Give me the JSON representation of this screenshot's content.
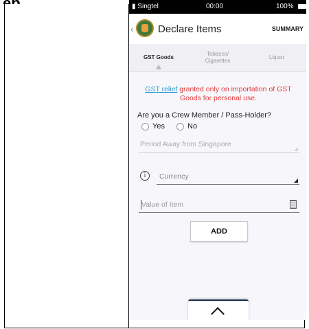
{
  "page": {
    "heading": "ep"
  },
  "status_bar": {
    "carrier": "Singtel",
    "time": "00:00",
    "battery": "100%"
  },
  "header": {
    "title": "Declare Items",
    "summary": "SUMMARY"
  },
  "tabs": [
    {
      "label": "GST Goods",
      "active": true
    },
    {
      "label": "Tobacco/\nCigarettes",
      "active": false
    },
    {
      "label": "Liquor",
      "active": false
    }
  ],
  "notice": {
    "link_text": "GST relief",
    "text": " granted only on importation of GST Goods for personal use."
  },
  "crew": {
    "question": "Are you a Crew Member / Pass-Holder?",
    "options": [
      {
        "label": "Yes"
      },
      {
        "label": "No"
      }
    ]
  },
  "form": {
    "period_placeholder": "Period Away from Singapore",
    "currency_placeholder": "Currency",
    "value_placeholder": "Value of Item",
    "add_label": "ADD"
  },
  "colors": {
    "notice_red": "#e23b3b",
    "link_blue": "#2a9ad1",
    "drawer_accent": "#1a2b4a"
  },
  "icons": [
    "back-chevron-icon",
    "customs-logo",
    "info-icon",
    "calculator-icon",
    "chevron-up-icon"
  ]
}
